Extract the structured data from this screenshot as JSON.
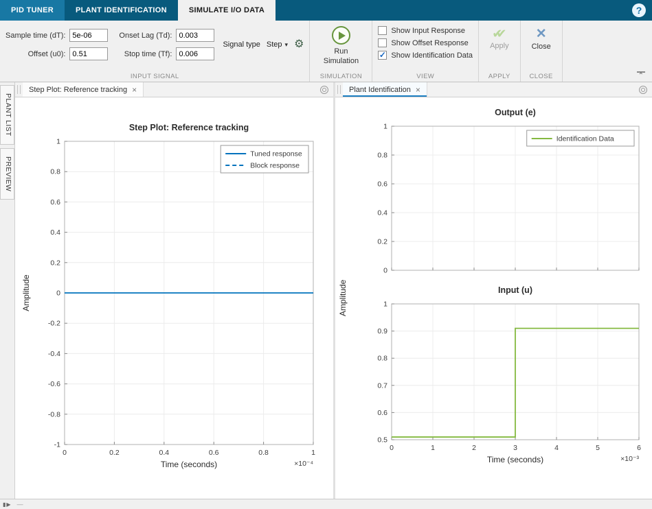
{
  "glyphs": {
    "close_tab": "×",
    "dropdown": "▾",
    "gear": "⚙",
    "help": "?",
    "apply": "✔✔",
    "close_x": "✕",
    "collapse": "⌃",
    "expand_panel": "▮▶",
    "handle": "—"
  },
  "tabbar": {
    "tabs": [
      {
        "label": "PID TUNER"
      },
      {
        "label": "PLANT IDENTIFICATION"
      },
      {
        "label": "SIMULATE I/O DATA"
      }
    ]
  },
  "ribbon": {
    "input_signal": {
      "section_label": "INPUT SIGNAL",
      "fields": [
        {
          "label": "Sample time (dT):",
          "value": "5e-06"
        },
        {
          "label": "Onset Lag (Td):",
          "value": "0.003"
        },
        {
          "label": "Offset (u0):",
          "value": "0.51"
        },
        {
          "label": "Stop time (Tf):",
          "value": "0.006"
        }
      ],
      "signal_type_label": "Signal type",
      "signal_type_value": "Step"
    },
    "simulation": {
      "section_label": "SIMULATION",
      "run_label": "Run Simulation"
    },
    "view": {
      "section_label": "VIEW",
      "checkboxes": [
        {
          "label": "Show Input Response",
          "checked": false
        },
        {
          "label": "Show Offset Response",
          "checked": false
        },
        {
          "label": "Show Identification Data",
          "checked": true
        }
      ]
    },
    "apply": {
      "section_label": "APPLY",
      "label": "Apply"
    },
    "close": {
      "section_label": "CLOSE",
      "label": "Close"
    }
  },
  "sidebar": {
    "tabs": [
      {
        "label": "PLANT LIST"
      },
      {
        "label": "PREVIEW"
      }
    ]
  },
  "panels": {
    "left": {
      "tab": "Step Plot: Reference tracking"
    },
    "right": {
      "tab": "Plant Identification",
      "shared_ylabel": "Amplitude"
    }
  },
  "chart_data": [
    {
      "id": "step",
      "type": "line",
      "title": "Step Plot: Reference tracking",
      "xlabel": "Time (seconds)",
      "ylabel": "Amplitude",
      "x_multiplier": "×10⁻⁴",
      "xlim": [
        0,
        1
      ],
      "ylim": [
        -1,
        1
      ],
      "xticks": [
        0,
        0.2,
        0.4,
        0.6,
        0.8,
        1
      ],
      "yticks": [
        -1,
        -0.8,
        -0.6,
        -0.4,
        -0.2,
        0,
        0.2,
        0.4,
        0.6,
        0.8,
        1
      ],
      "xtick_labels": true,
      "legend": true,
      "grid": true,
      "series": [
        {
          "name": "Tuned response",
          "color": "#0072bd",
          "style": "solid",
          "x": [
            0,
            1
          ],
          "y": [
            0,
            0
          ]
        },
        {
          "name": "Block response",
          "color": "#0072bd",
          "style": "dashed",
          "x": [],
          "y": []
        }
      ]
    },
    {
      "id": "output",
      "type": "line",
      "title": "Output (e)",
      "xlabel": "",
      "ylabel": "",
      "xlim": [
        0,
        6
      ],
      "ylim": [
        0,
        1
      ],
      "xticks": [
        0,
        1,
        2,
        3,
        4,
        5,
        6
      ],
      "yticks": [
        0,
        0.2,
        0.4,
        0.6,
        0.8,
        1
      ],
      "xtick_labels": false,
      "legend": true,
      "grid": true,
      "series": [
        {
          "name": "Identification Data",
          "color": "#84b940",
          "style": "solid",
          "x": [],
          "y": []
        }
      ]
    },
    {
      "id": "input",
      "type": "line",
      "title": "Input (u)",
      "xlabel": "Time (seconds)",
      "ylabel": "",
      "x_multiplier": "×10⁻³",
      "xlim": [
        0,
        6
      ],
      "ylim": [
        0.5,
        1
      ],
      "xticks": [
        0,
        1,
        2,
        3,
        4,
        5,
        6
      ],
      "yticks": [
        0.5,
        0.6,
        0.7,
        0.8,
        0.9,
        1
      ],
      "xtick_labels": true,
      "legend": false,
      "grid": true,
      "series": [
        {
          "name": "Identification Data",
          "color": "#84b940",
          "style": "solid",
          "x": [
            0,
            3,
            3,
            6
          ],
          "y": [
            0.51,
            0.51,
            0.91,
            0.91
          ]
        }
      ]
    }
  ],
  "statusbar": {}
}
